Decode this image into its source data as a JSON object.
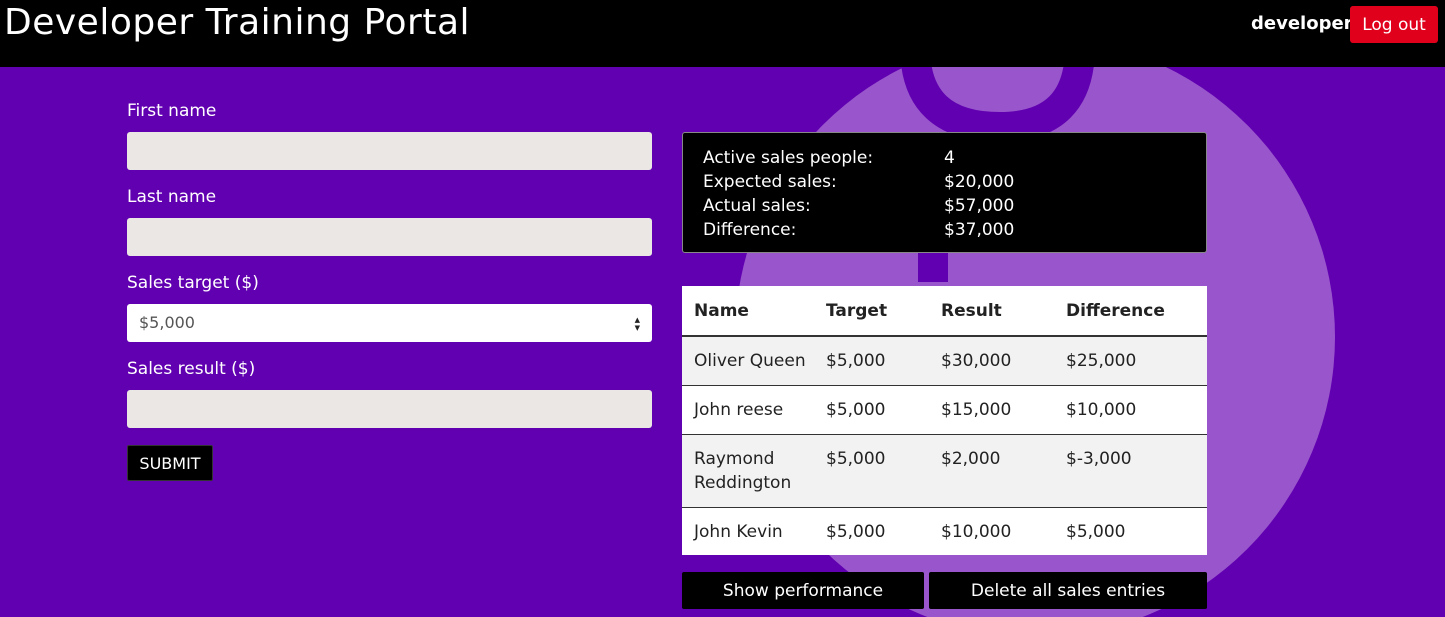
{
  "header": {
    "title": "Developer Training Portal",
    "username": "developer",
    "logout_label": "Log out"
  },
  "form": {
    "first_name_label": "First name",
    "first_name_value": "",
    "last_name_label": "Last name",
    "last_name_value": "",
    "sales_target_label": "Sales target ($)",
    "sales_target_selected": "$5,000",
    "sales_result_label": "Sales result ($)",
    "sales_result_value": "",
    "submit_label": "SUBMIT"
  },
  "summary": {
    "rows": [
      {
        "label": "Active sales people:",
        "value": "4"
      },
      {
        "label": "Expected sales:",
        "value": "$20,000"
      },
      {
        "label": "Actual sales:",
        "value": "$57,000"
      },
      {
        "label": "Difference:",
        "value": "$37,000"
      }
    ]
  },
  "table": {
    "headers": [
      "Name",
      "Target",
      "Result",
      "Difference"
    ],
    "rows": [
      [
        "Oliver Queen",
        "$5,000",
        "$30,000",
        "$25,000"
      ],
      [
        "John reese",
        "$5,000",
        "$15,000",
        "$10,000"
      ],
      [
        "Raymond Reddington",
        "$5,000",
        "$2,000",
        "$-3,000"
      ],
      [
        "John Kevin",
        "$5,000",
        "$10,000",
        "$5,000"
      ]
    ]
  },
  "actions": {
    "show_performance_label": "Show performance",
    "delete_all_label": "Delete all sales entries"
  },
  "colors": {
    "background": "#6100b0",
    "logout": "#e0001b",
    "header": "#000000"
  }
}
